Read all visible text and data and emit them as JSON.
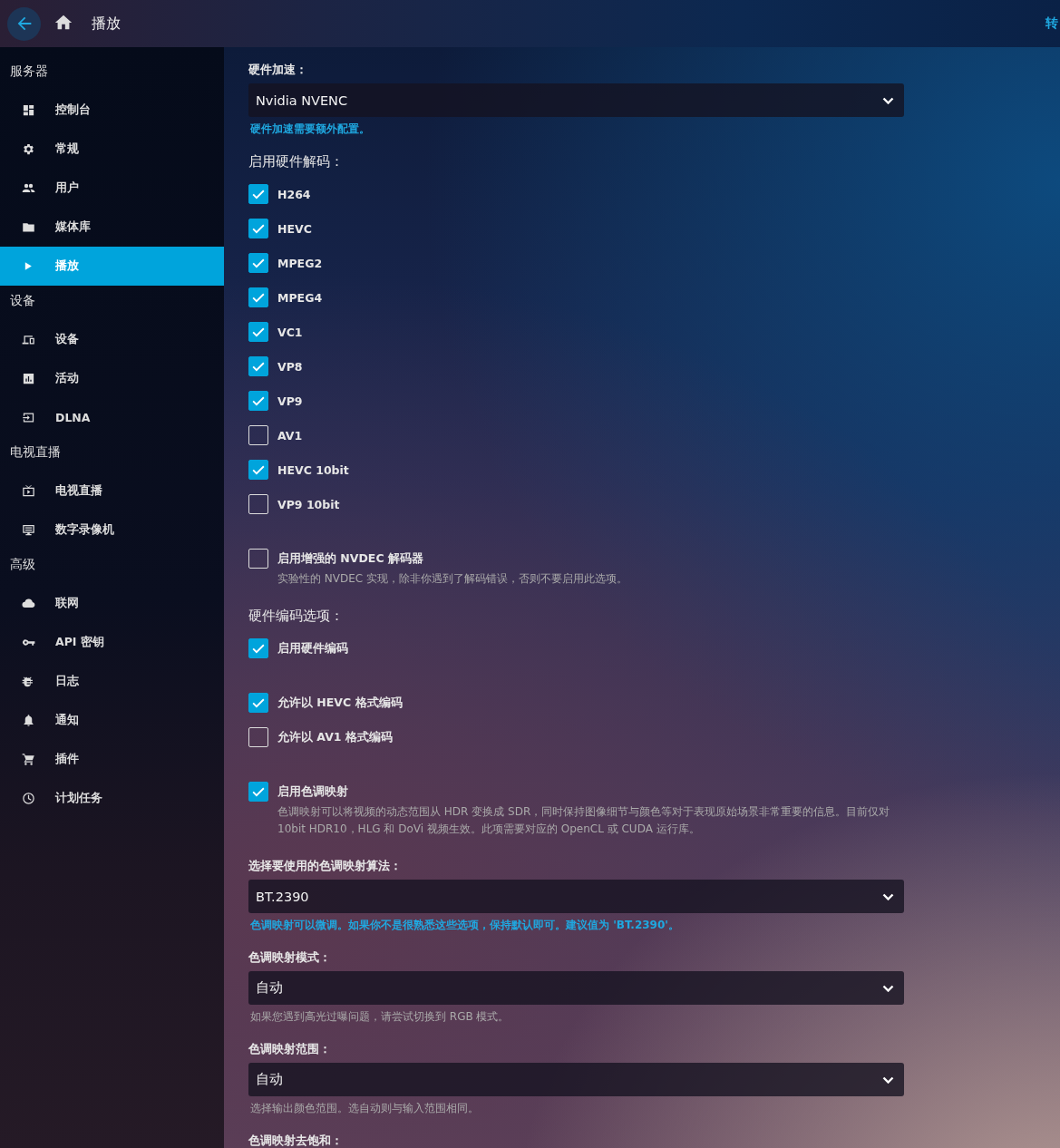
{
  "header": {
    "title": "播放",
    "right_link": "转"
  },
  "sidebar": [
    {
      "heading": "服务器",
      "items": [
        {
          "label": "控制台",
          "kind": "dashboard",
          "selected": false
        },
        {
          "label": "常规",
          "kind": "gear",
          "selected": false
        },
        {
          "label": "用户",
          "kind": "users",
          "selected": false
        },
        {
          "label": "媒体库",
          "kind": "folder",
          "selected": false
        },
        {
          "label": "播放",
          "kind": "play",
          "selected": true
        }
      ]
    },
    {
      "heading": "设备",
      "items": [
        {
          "label": "设备",
          "kind": "devices",
          "selected": false
        },
        {
          "label": "活动",
          "kind": "chart",
          "selected": false
        },
        {
          "label": "DLNA",
          "kind": "input",
          "selected": false
        }
      ]
    },
    {
      "heading": "电视直播",
      "items": [
        {
          "label": "电视直播",
          "kind": "tv",
          "selected": false
        },
        {
          "label": "数字录像机",
          "kind": "dvr",
          "selected": false
        }
      ]
    },
    {
      "heading": "高级",
      "items": [
        {
          "label": "联网",
          "kind": "cloud",
          "selected": false
        },
        {
          "label": "API 密钥",
          "kind": "key",
          "selected": false
        },
        {
          "label": "日志",
          "kind": "bug",
          "selected": false
        },
        {
          "label": "通知",
          "kind": "bell",
          "selected": false
        },
        {
          "label": "插件",
          "kind": "cart",
          "selected": false
        },
        {
          "label": "计划任务",
          "kind": "clock",
          "selected": false
        }
      ]
    }
  ],
  "form": [
    {
      "kind": "select",
      "label": "硬件加速：",
      "value": "Nvidia NVENC",
      "hint": "硬件加速需要额外配置。",
      "hint_accent": true
    },
    {
      "kind": "checklist",
      "label": "启用硬件解码：",
      "items": [
        {
          "label": "H264",
          "checked": true
        },
        {
          "label": "HEVC",
          "checked": true
        },
        {
          "label": "MPEG2",
          "checked": true
        },
        {
          "label": "MPEG4",
          "checked": true
        },
        {
          "label": "VC1",
          "checked": true
        },
        {
          "label": "VP8",
          "checked": true
        },
        {
          "label": "VP9",
          "checked": true
        },
        {
          "label": "AV1",
          "checked": false
        },
        {
          "label": "HEVC 10bit",
          "checked": true
        },
        {
          "label": "VP9 10bit",
          "checked": false
        }
      ]
    },
    {
      "kind": "checklist",
      "items": [
        {
          "label": "启用增强的 NVDEC 解码器",
          "checked": false,
          "description": "实验性的 NVDEC 实现，除非你遇到了解码错误，否则不要启用此选项。"
        }
      ]
    },
    {
      "kind": "checklist",
      "label": "硬件编码选项：",
      "items": [
        {
          "label": "启用硬件编码",
          "checked": true
        }
      ]
    },
    {
      "kind": "checklist",
      "items": [
        {
          "label": "允许以 HEVC 格式编码",
          "checked": true
        },
        {
          "label": "允许以 AV1 格式编码",
          "checked": false
        }
      ]
    },
    {
      "kind": "checklist",
      "items": [
        {
          "label": "启用色调映射",
          "checked": true,
          "description": "色调映射可以将视频的动态范围从 HDR 变换成 SDR，同时保持图像细节与颜色等对于表现原始场景非常重要的信息。目前仅对 10bit HDR10，HLG 和 DoVi 视频生效。此项需要对应的 OpenCL 或 CUDA 运行库。"
        }
      ]
    },
    {
      "kind": "select",
      "label": "选择要使用的色调映射算法：",
      "value": "BT.2390",
      "hint": "色调映射可以微调。如果你不是很熟悉这些选项，保持默认即可。建议值为 'BT.2390'。",
      "hint_accent": true
    },
    {
      "kind": "select",
      "label": "色调映射模式：",
      "value": "自动",
      "hint": "如果您遇到高光过曝问题，请尝试切换到 RGB 模式。",
      "hint_accent": false
    },
    {
      "kind": "select",
      "label": "色调映射范围：",
      "value": "自动",
      "hint": "选择输出颜色范围。选自动则与输入范围相同。",
      "hint_accent": false
    },
    {
      "kind": "label",
      "label": "色调映射去饱和："
    }
  ]
}
